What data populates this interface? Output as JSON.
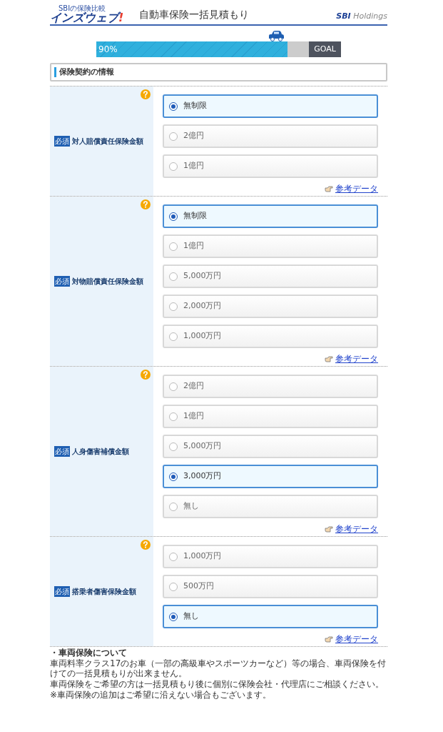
{
  "header": {
    "logo_small": "SBIの保険比較",
    "logo_main": "インズウェブ",
    "logo_mark": "!",
    "title": "自動車保険一括見積もり",
    "partner_logo": "SBI",
    "partner_name": "Holdings"
  },
  "progress": {
    "level": 0.9,
    "label": "90%",
    "goal": "GOAL"
  },
  "section_title": "保険契約の情報",
  "questions": [
    {
      "badge": "必須",
      "label": "対人賠償責任保険金額",
      "link": "参考データ",
      "options": [
        {
          "label": "無制限",
          "selected": true
        },
        {
          "label": "2億円",
          "selected": false
        },
        {
          "label": "1億円",
          "selected": false
        }
      ]
    },
    {
      "badge": "必須",
      "label": "対物賠償責任保険金額",
      "link": "参考データ",
      "options": [
        {
          "label": "無制限",
          "selected": true
        },
        {
          "label": "1億円",
          "selected": false
        },
        {
          "label": "5,000万円",
          "selected": false
        },
        {
          "label": "2,000万円",
          "selected": false
        },
        {
          "label": "1,000万円",
          "selected": false
        }
      ]
    },
    {
      "badge": "必須",
      "label": "人身傷害補償金額",
      "link": "参考データ",
      "options": [
        {
          "label": "2億円",
          "selected": false
        },
        {
          "label": "1億円",
          "selected": false
        },
        {
          "label": "5,000万円",
          "selected": false
        },
        {
          "label": "3,000万円",
          "selected": true
        },
        {
          "label": "無し",
          "selected": false
        }
      ]
    },
    {
      "badge": "必須",
      "label": "搭乗者傷害保険金額",
      "link": "参考データ",
      "options": [
        {
          "label": "1,000万円",
          "selected": false
        },
        {
          "label": "500万円",
          "selected": false
        },
        {
          "label": "無し",
          "selected": true
        }
      ]
    }
  ],
  "notes": {
    "heading": "・車両保険について",
    "lines": [
      "車両料率クラス17のお車（一部の高級車やスポーツカーなど）等の場合、車両保険を付けての一括見積もりが出来ません。",
      "車両保険をご希望の方は一括見積もり後に個別に保険会社・代理店にご相談ください。",
      "※車両保険の追加はご希望に沿えない場合もございます。"
    ]
  }
}
